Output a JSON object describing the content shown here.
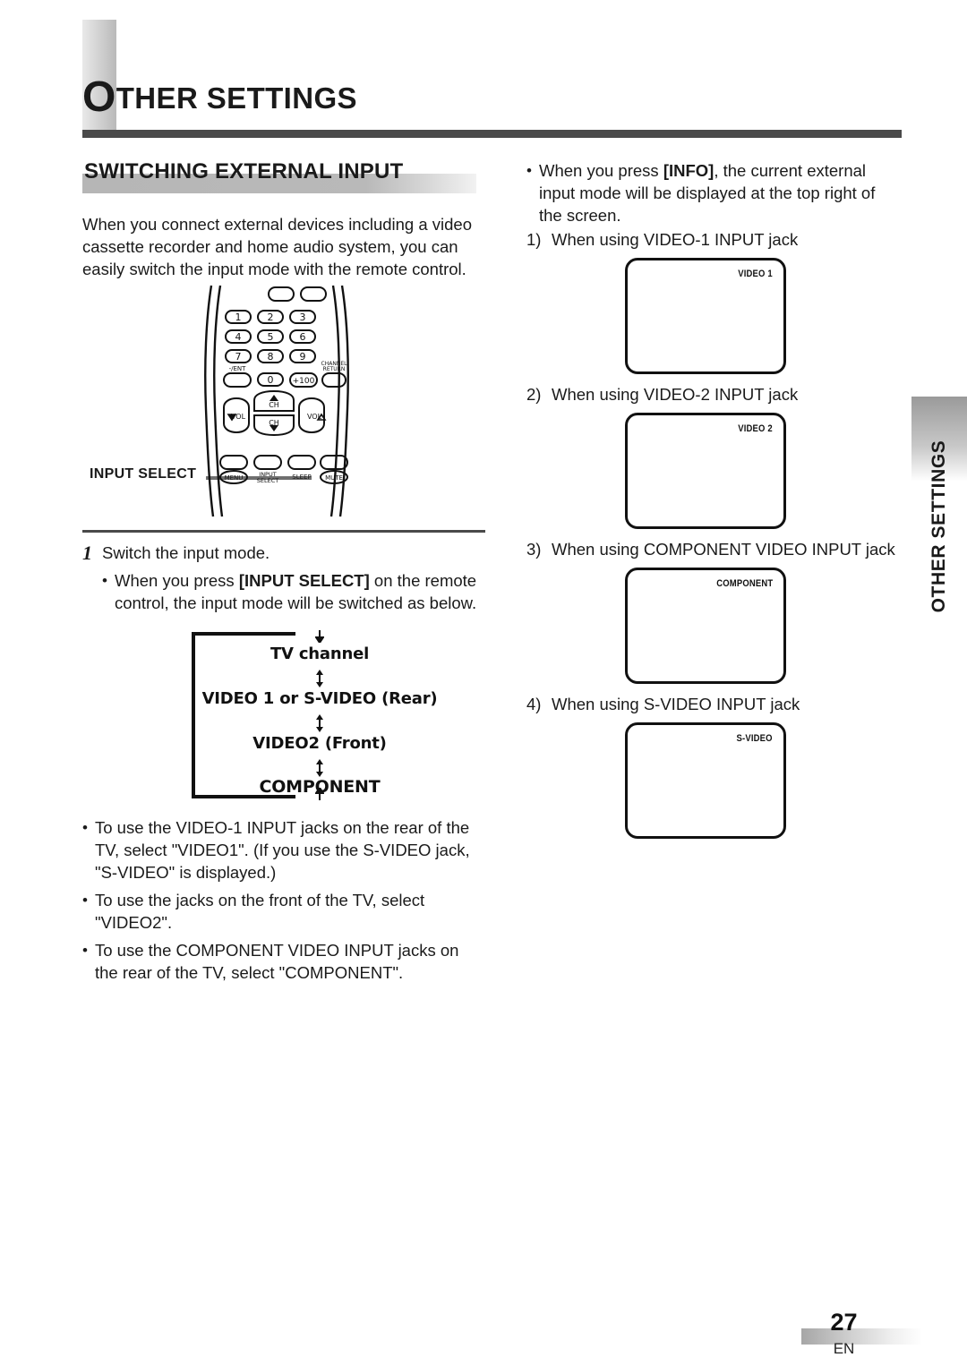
{
  "header": {
    "chapter_dropcap": "O",
    "chapter_rest": "THER SETTINGS"
  },
  "section": {
    "heading": "SWITCHING EXTERNAL INPUT",
    "intro": "When you connect external devices including a video cassette recorder and home audio system, you can easily switch the input mode with the remote control."
  },
  "remote": {
    "callout_label": "INPUT SELECT",
    "keys": {
      "numbers": [
        "1",
        "2",
        "3",
        "4",
        "5",
        "6",
        "7",
        "8",
        "9",
        "0"
      ],
      "ent": "-/ENT",
      "plus100": "+100",
      "channel_return": "CHANNEL RETURN",
      "vol_down": "VOL",
      "vol_up": "VOL",
      "ch_up": "CH",
      "ch_down": "CH",
      "menu": "MENU",
      "input_select_line1": "INPUT",
      "input_select_line2": "SELECT",
      "sleep": "SLEEP",
      "mute": "MUTE"
    }
  },
  "step": {
    "number": "1",
    "title": "Switch the input mode.",
    "bullet_prefix": "When you press ",
    "bullet_key": "[INPUT SELECT]",
    "bullet_suffix": " on the remote control, the input mode will be switched as below."
  },
  "flow": {
    "items": [
      "TV channel",
      "VIDEO 1 or S-VIDEO (Rear)",
      "VIDEO2 (Front)",
      "COMPONENT"
    ]
  },
  "notes": [
    "To use the VIDEO-1 INPUT jacks on the rear of the TV, select \"VIDEO1\". (If you use the S-VIDEO jack, \"S-VIDEO\" is displayed.)",
    "To use the jacks on the front of the TV, select \"VIDEO2\".",
    "To use the COMPONENT VIDEO INPUT jacks on the rear of the TV, select \"COMPONENT\"."
  ],
  "right": {
    "info_prefix": "When you press ",
    "info_key": "[INFO]",
    "info_suffix": ", the current external input mode will be displayed at the top right of the screen.",
    "cases": [
      {
        "num": "1)",
        "text": "When using VIDEO-1 INPUT jack",
        "osd": "VIDEO 1"
      },
      {
        "num": "2)",
        "text": "When using VIDEO-2 INPUT jack",
        "osd": "VIDEO 2"
      },
      {
        "num": "3)",
        "text": "When using COMPONENT VIDEO INPUT jack",
        "osd": "COMPONENT"
      },
      {
        "num": "4)",
        "text": "When using S-VIDEO INPUT jack",
        "osd": "S-VIDEO"
      }
    ]
  },
  "side_tab": {
    "label": "OTHER SETTINGS"
  },
  "footer": {
    "page_number": "27",
    "language": "EN"
  },
  "colors": {
    "ink": "#1a1a1a",
    "rule": "#4a4a4a",
    "swatch": "#b9b9b9"
  }
}
